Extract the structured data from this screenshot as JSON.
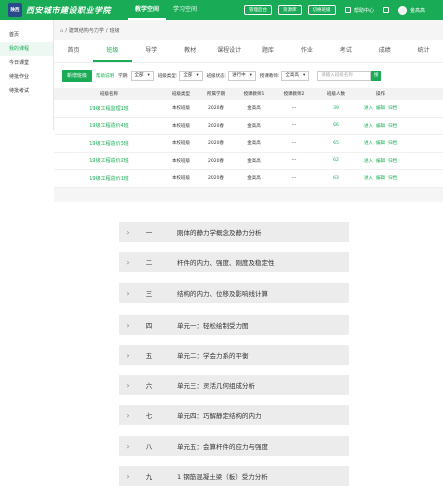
{
  "header": {
    "logo_text": "陕西",
    "school_name": "西安城市建设职业学院",
    "nav": [
      "教学空间",
      "学习空间"
    ],
    "buttons": [
      "管理后台",
      "资源库",
      "切换班级"
    ],
    "help": "帮助中心",
    "user": "金高高"
  },
  "sidebar": {
    "items": [
      "首页",
      "我的课程",
      "今日课堂",
      "待批作业",
      "待批考试"
    ]
  },
  "breadcrumb": {
    "course": "建筑结构与力学",
    "current": "班级"
  },
  "tabs": [
    "首页",
    "班级",
    "导学",
    "教材",
    "课程设计",
    "题库",
    "作业",
    "考试",
    "成绩",
    "统计"
  ],
  "toolbar": {
    "new_button": "新增班级",
    "help_link": "帮助说明",
    "filters": [
      {
        "label": "学期:",
        "value": "全部"
      },
      {
        "label": "班级类型:",
        "value": "全部"
      },
      {
        "label": "班级状态:",
        "value": "进行中"
      },
      {
        "label": "授课教师:",
        "value": "全高高"
      }
    ],
    "search_placeholder": "请输入班级名称",
    "search_button": "搜"
  },
  "table": {
    "headers": [
      "班级名称",
      "班级类型",
      "所属学期",
      "授课教师1",
      "授课教师2",
      "班级人数",
      "操作"
    ],
    "rows": [
      {
        "name": "19级工程监理1班",
        "type": "本校班级",
        "semester": "2020春",
        "teacher1": "金高高",
        "teacher2": "---",
        "count": "39",
        "ops": [
          "进入",
          "编辑",
          "归档"
        ]
      },
      {
        "name": "19级工程造价4班",
        "type": "本校班级",
        "semester": "2020春",
        "teacher1": "金高高",
        "teacher2": "---",
        "count": "66",
        "ops": [
          "进入",
          "编辑",
          "归档"
        ]
      },
      {
        "name": "19级工程造价3班",
        "type": "本校班级",
        "semester": "2020春",
        "teacher1": "金高高",
        "teacher2": "---",
        "count": "65",
        "ops": [
          "进入",
          "编辑",
          "归档"
        ]
      },
      {
        "name": "19级工程造价2班",
        "type": "本校班级",
        "semester": "2020春",
        "teacher1": "金高高",
        "teacher2": "---",
        "count": "62",
        "ops": [
          "进入",
          "编辑",
          "归档"
        ]
      },
      {
        "name": "19级工程造价1班",
        "type": "本校班级",
        "semester": "2020春",
        "teacher1": "金高高",
        "teacher2": "---",
        "count": "63",
        "ops": [
          "进入",
          "编辑",
          "归档"
        ]
      }
    ]
  },
  "outline": {
    "items": [
      {
        "num": "一",
        "title": "刚体的静力学概念及静力分析"
      },
      {
        "num": "二",
        "title": "杆件的内力、强度、刚度及稳定性"
      },
      {
        "num": "三",
        "title": "结构的内力、位移及影响线计算"
      },
      {
        "num": "四",
        "title": "单元一：轻松绘制受力图"
      },
      {
        "num": "五",
        "title": "单元二：学会力系的平衡"
      },
      {
        "num": "六",
        "title": "单元三：灵活几何组成分析"
      },
      {
        "num": "七",
        "title": "单元四：巧解静定结构的内力"
      },
      {
        "num": "八",
        "title": "单元五：会算杆件的应力与强度"
      },
      {
        "num": "九",
        "title": "1 钢筋混凝土梁（板）受力分析"
      }
    ]
  }
}
